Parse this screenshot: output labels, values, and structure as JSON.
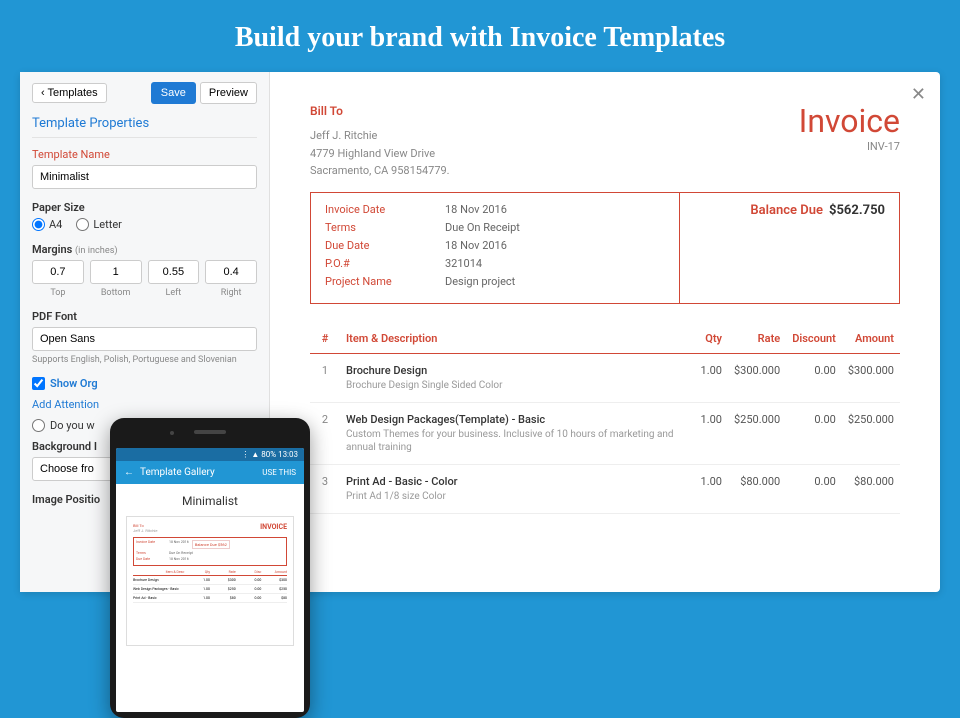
{
  "hero": "Build your brand with Invoice Templates",
  "close": "✕",
  "sidebar": {
    "back": "Templates",
    "save": "Save",
    "preview": "Preview",
    "section": "Template Properties",
    "tplNameLabel": "Template Name",
    "tplName": "Minimalist",
    "paperSizeLabel": "Paper Size",
    "a4": "A4",
    "letter": "Letter",
    "marginsLabel": "Margins",
    "marginsUnit": "(in inches)",
    "margins": {
      "top": "0.7",
      "bottom": "1",
      "left": "0.55",
      "right": "0.4"
    },
    "marginLabels": {
      "top": "Top",
      "bottom": "Bottom",
      "left": "Left",
      "right": "Right"
    },
    "pdfFontLabel": "PDF Font",
    "pdfFont": "Open Sans",
    "pdfHelper": "Supports English, Polish, Portuguese and Slovenian",
    "showOrg": "Show Org",
    "addAttn": "Add Attention",
    "doYou": "Do you w",
    "bgLabel": "Background I",
    "bgChoose": "Choose fro",
    "imgPos": "Image Positio"
  },
  "phone": {
    "status": "⋮ ▲ 80% 13:03",
    "back": "←",
    "title": "Template Gallery",
    "use": "USE THIS",
    "name": "Minimalist"
  },
  "invoice": {
    "billToLabel": "Bill To",
    "billName": "Jeff J. Ritchie",
    "billAddr1": "4779 Highland View Drive",
    "billAddr2": "Sacramento, CA 958154779.",
    "title": "Invoice",
    "number": "INV-17",
    "meta": [
      {
        "k": "Invoice Date",
        "v": "18 Nov 2016"
      },
      {
        "k": "Terms",
        "v": "Due On Receipt"
      },
      {
        "k": "Due Date",
        "v": "18 Nov 2016"
      },
      {
        "k": "P.O.#",
        "v": "321014"
      },
      {
        "k": "Project Name",
        "v": "Design project"
      }
    ],
    "balLabel": "Balance Due",
    "balVal": "$562.750",
    "cols": {
      "num": "#",
      "item": "Item & Description",
      "qty": "Qty",
      "rate": "Rate",
      "disc": "Discount",
      "amt": "Amount"
    },
    "items": [
      {
        "n": "1",
        "name": "Brochure Design",
        "desc": "Brochure Design Single Sided Color",
        "qty": "1.00",
        "rate": "$300.000",
        "disc": "0.00",
        "amt": "$300.000"
      },
      {
        "n": "2",
        "name": "Web Design Packages(Template) - Basic",
        "desc": "Custom Themes for your business. Inclusive of 10 hours of marketing and annual training",
        "qty": "1.00",
        "rate": "$250.000",
        "disc": "0.00",
        "amt": "$250.000"
      },
      {
        "n": "3",
        "name": "Print Ad - Basic - Color",
        "desc": "Print Ad 1/8 size Color",
        "qty": "1.00",
        "rate": "$80.000",
        "disc": "0.00",
        "amt": "$80.000"
      }
    ]
  }
}
